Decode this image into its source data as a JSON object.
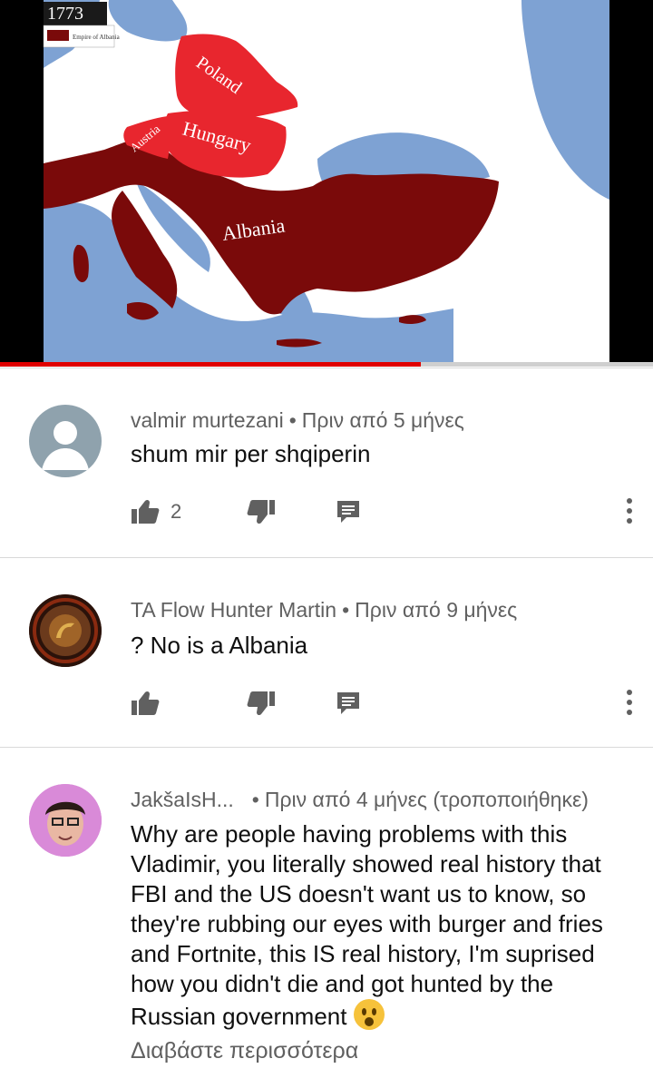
{
  "video": {
    "year_label": "1773",
    "legend_label": "Empire of Albania",
    "map_labels": {
      "poland": "Poland",
      "hungary": "Hungary",
      "austria": "Austria",
      "albania": "Albania"
    },
    "progress_fraction": 0.645,
    "colors": {
      "sea": "#7ea2d3",
      "land": "#ffffff",
      "empire": "#7a0a0a",
      "claims": "#e8262e",
      "progress": "#e00000"
    }
  },
  "comments": [
    {
      "author": "valmir murtezani",
      "time": "Πριν από 5 μήνες",
      "text": "shum mir per shqiperin",
      "likes": "2",
      "avatar": "default-avatar"
    },
    {
      "author": "TA Flow Hunter Martin",
      "time": "Πριν από 9 μήνες",
      "text": "? No is a Albania",
      "likes": "",
      "avatar": "emblem-avatar"
    },
    {
      "author": "JakšaIsH...",
      "time": "Πριν από 4 μήνες (τροποποιήθηκε)",
      "text": "Why are people having problems with this Vladimir, you literally showed real history that FBI and the US doesn't want us to know, so they're rubbing our eyes with burger and fries and Fortnite, this IS real history, I'm suprised how you didn't die and got hunted by the Russian government",
      "likes": "",
      "avatar": "face-avatar",
      "emoji": "surprised-face"
    }
  ],
  "read_more": "Διαβάστε περισσότερα"
}
